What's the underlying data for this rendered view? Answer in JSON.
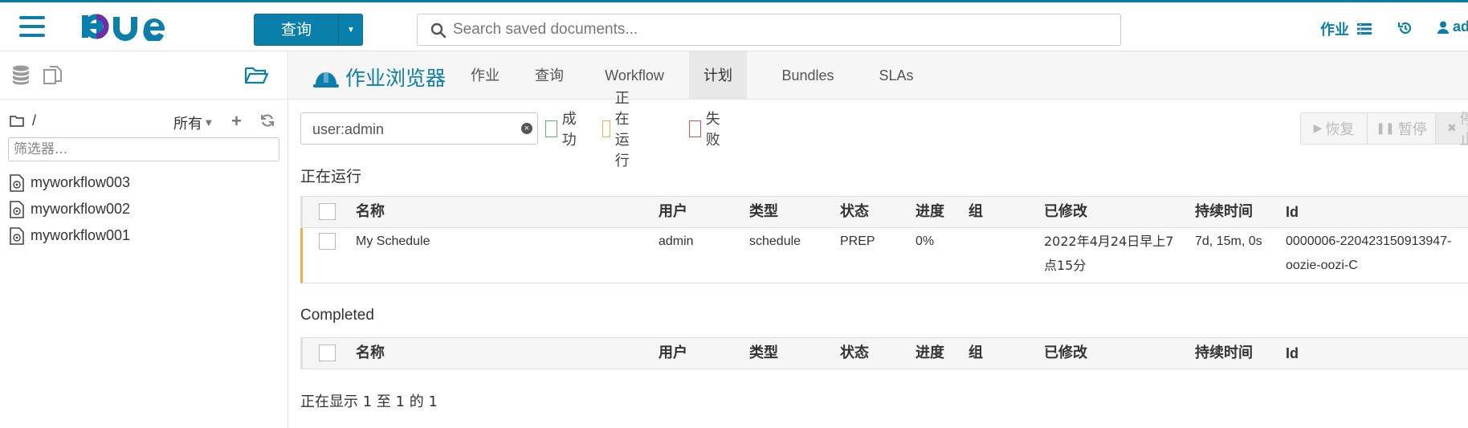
{
  "topbar": {
    "query_label": "查询",
    "search_placeholder": "Search saved documents...",
    "jobs_label": "作业",
    "user_label": "admin",
    "brand_color": "#0b7fab"
  },
  "leftpanel": {
    "path": "/",
    "all_label": "所有",
    "filter_placeholder": "筛选器...",
    "files": [
      "myworkflow003",
      "myworkflow002",
      "myworkflow001"
    ]
  },
  "subnav": {
    "app_title": "作业浏览器",
    "tabs": [
      {
        "label": "作业",
        "active": false
      },
      {
        "label": "查询",
        "active": false
      },
      {
        "label": "Workflow",
        "active": false
      },
      {
        "label": "计划",
        "active": true
      },
      {
        "label": "Bundles",
        "active": false
      },
      {
        "label": "SLAs",
        "active": false
      }
    ]
  },
  "filters": {
    "user_filter_value": "user:admin",
    "checks": [
      {
        "label": "成功",
        "color": "#5cb85c"
      },
      {
        "label": "正在运行",
        "color": "#f0ad4e"
      },
      {
        "label": "失败",
        "color": "#d9534f"
      }
    ]
  },
  "actions": {
    "resume": "恢复",
    "pause": "暂停",
    "kill": "停止"
  },
  "running": {
    "title": "正在运行",
    "columns": [
      "名称",
      "用户",
      "类型",
      "状态",
      "进度",
      "组",
      "已修改",
      "持续时间",
      "Id"
    ],
    "rows": [
      {
        "name": "My Schedule",
        "user": "admin",
        "type": "schedule",
        "status": "PREP",
        "progress": "0%",
        "group": "",
        "modified_line1": "2022年4月24日早上7",
        "modified_line2": "点15分",
        "duration": "7d, 15m, 0s",
        "id_line1": "0000006-220423150913947-",
        "id_line2": "oozie-oozi-C"
      }
    ]
  },
  "completed": {
    "title": "Completed",
    "columns": [
      "名称",
      "用户",
      "类型",
      "状态",
      "进度",
      "组",
      "已修改",
      "持续时间",
      "Id"
    ]
  },
  "footer": {
    "showing": "正在显示 1 至 1 的 1"
  }
}
